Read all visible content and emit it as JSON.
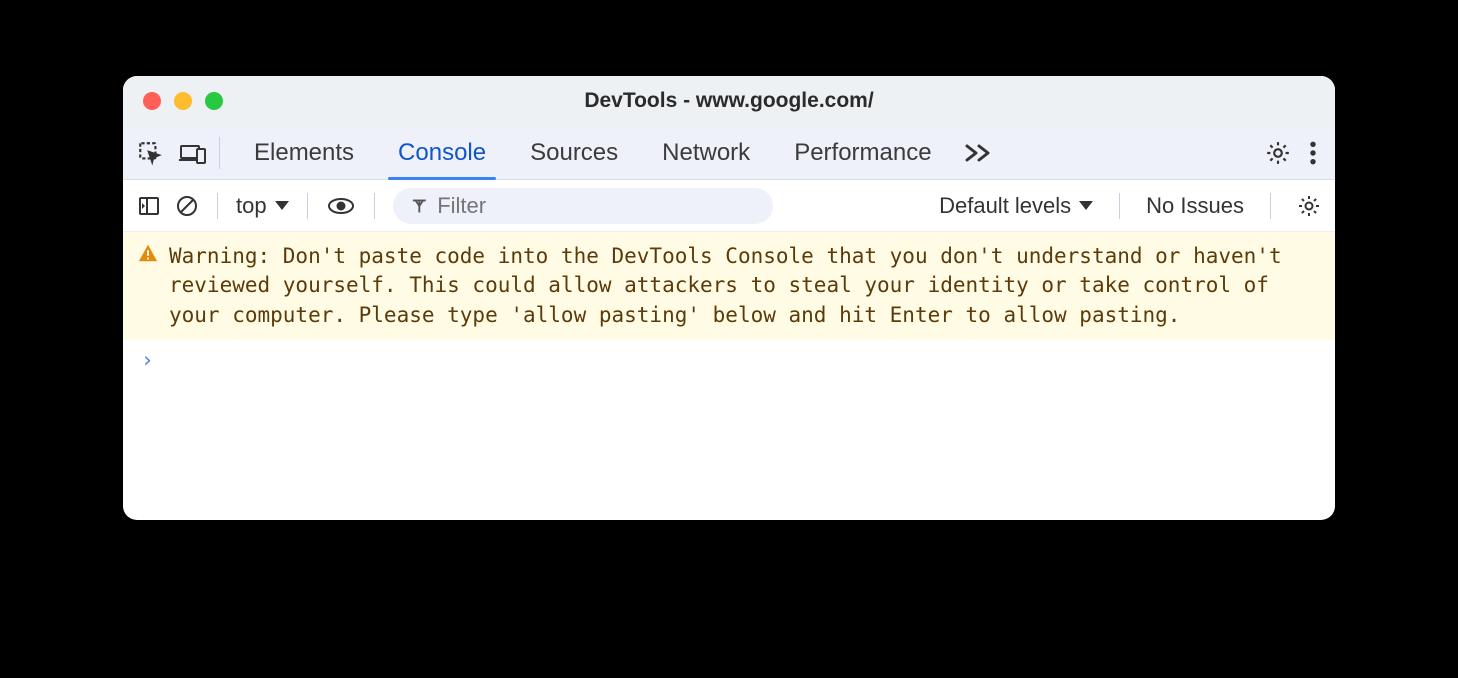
{
  "window": {
    "title": "DevTools - www.google.com/"
  },
  "tabs": {
    "items": [
      {
        "label": "Elements"
      },
      {
        "label": "Console"
      },
      {
        "label": "Sources"
      },
      {
        "label": "Network"
      },
      {
        "label": "Performance"
      }
    ],
    "active_index": 1
  },
  "toolbar": {
    "context": "top",
    "filter_placeholder": "Filter",
    "levels": "Default levels",
    "issues": "No Issues"
  },
  "console": {
    "warning": "Warning: Don't paste code into the DevTools Console that you don't understand or haven't reviewed yourself. This could allow attackers to steal your identity or take control of your computer. Please type 'allow pasting' below and hit Enter to allow pasting."
  }
}
